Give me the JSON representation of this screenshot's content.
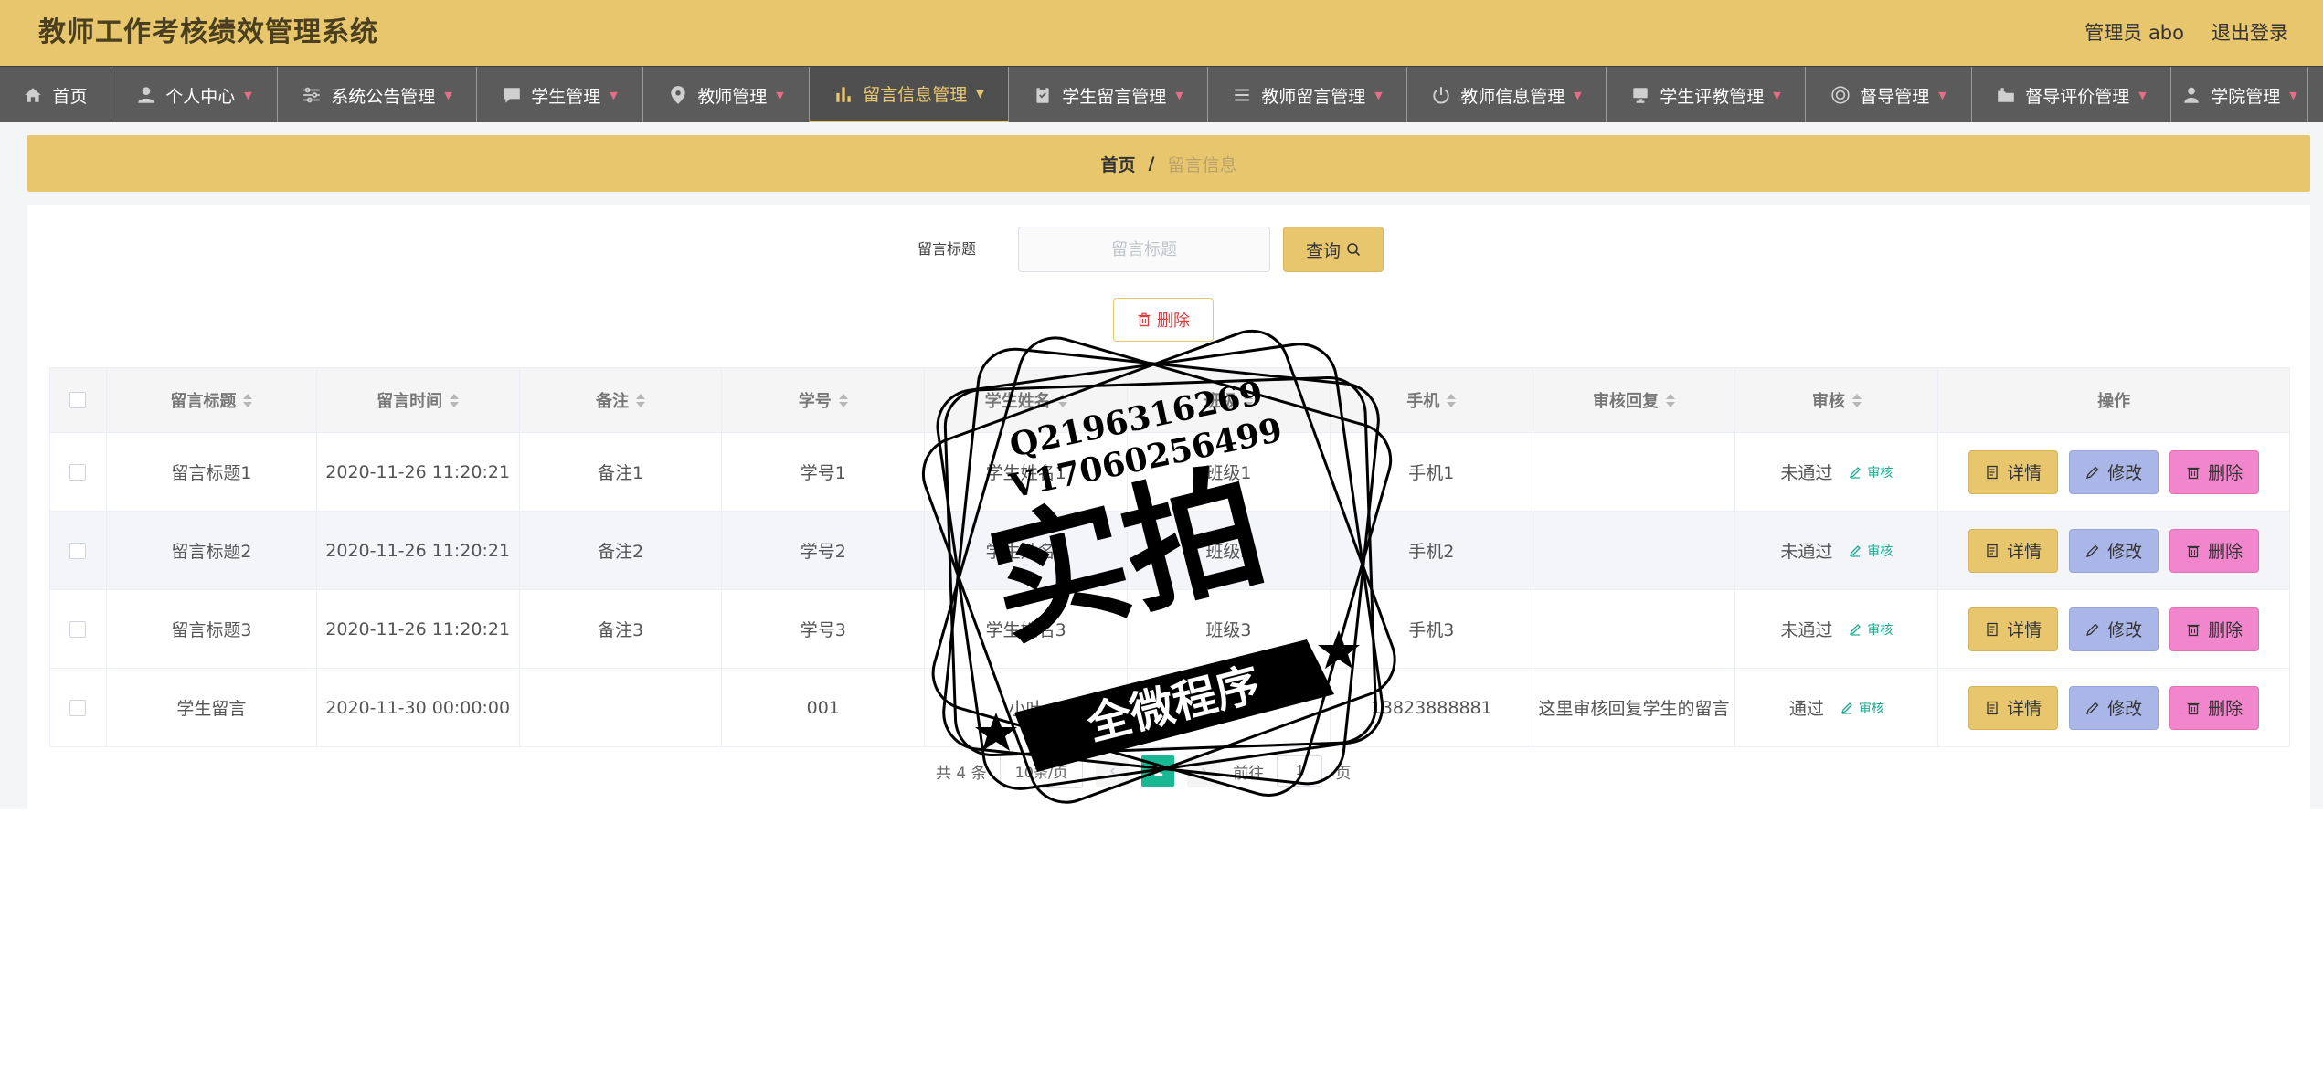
{
  "header": {
    "title": "教师工作考核绩效管理系统",
    "user": "管理员 abo",
    "logout": "退出登录"
  },
  "nav": {
    "items": [
      {
        "label": "首页",
        "icon": "home-icon",
        "has_arrow": false
      },
      {
        "label": "个人中心",
        "icon": "user-icon",
        "has_arrow": true
      },
      {
        "label": "系统公告管理",
        "icon": "sliders-icon",
        "has_arrow": true
      },
      {
        "label": "学生管理",
        "icon": "chat-icon",
        "has_arrow": true
      },
      {
        "label": "教师管理",
        "icon": "location-icon",
        "has_arrow": true
      },
      {
        "label": "留言信息管理",
        "icon": "bar-chart-icon",
        "has_arrow": true,
        "active": true
      },
      {
        "label": "学生留言管理",
        "icon": "clipboard-icon",
        "has_arrow": true
      },
      {
        "label": "教师留言管理",
        "icon": "list-icon",
        "has_arrow": true
      },
      {
        "label": "教师信息管理",
        "icon": "power-icon",
        "has_arrow": true
      },
      {
        "label": "学生评教管理",
        "icon": "monitor-icon",
        "has_arrow": true
      },
      {
        "label": "督导管理",
        "icon": "globe-icon",
        "has_arrow": true
      },
      {
        "label": "督导评价管理",
        "icon": "folder-icon",
        "has_arrow": true
      },
      {
        "label": "学院管理",
        "icon": "person-icon",
        "has_arrow": true
      }
    ]
  },
  "breadcrumb": {
    "home": "首页",
    "separator": "/",
    "current": "留言信息"
  },
  "search": {
    "label": "留言标题",
    "placeholder": "留言标题",
    "query_button": "查询"
  },
  "toolbar": {
    "delete_button": "删除"
  },
  "table": {
    "columns": [
      "留言标题",
      "留言时间",
      "备注",
      "学号",
      "学生姓名",
      "班级",
      "手机",
      "审核回复",
      "审核",
      "操作"
    ],
    "rows": [
      {
        "title": "留言标题1",
        "time": "2020-11-26 11:20:21",
        "note": "备注1",
        "student_no": "学号1",
        "student_name": "学生姓名1",
        "class": "班级1",
        "phone": "手机1",
        "reply": "",
        "status": "未通过"
      },
      {
        "title": "留言标题2",
        "time": "2020-11-26 11:20:21",
        "note": "备注2",
        "student_no": "学号2",
        "student_name": "学生姓名2",
        "class": "班级2",
        "phone": "手机2",
        "reply": "",
        "status": "未通过"
      },
      {
        "title": "留言标题3",
        "time": "2020-11-26 11:20:21",
        "note": "备注3",
        "student_no": "学号3",
        "student_name": "学生姓名3",
        "class": "班级3",
        "phone": "手机3",
        "reply": "",
        "status": "未通过"
      },
      {
        "title": "学生留言",
        "time": "2020-11-30 00:00:00",
        "note": "",
        "student_no": "001",
        "student_name": "小叶",
        "class": "",
        "phone": "13823888881",
        "reply": "这里审核回复学生的留言",
        "status": "通过"
      }
    ],
    "audit_link": "审核",
    "actions": {
      "detail": "详情",
      "edit": "修改",
      "delete": "删除"
    }
  },
  "pagination": {
    "total": "共 4 条",
    "page_size": "10条/页",
    "current_page": "1",
    "goto_prefix": "前往",
    "goto_value": "1",
    "goto_suffix": "页"
  },
  "watermark": {
    "line1": "Q2196316269",
    "line2": "V17060256499",
    "main": "实拍",
    "banner": "全微程序"
  },
  "colors": {
    "accent": "#e8c66d",
    "nav_bg": "#5b5b5b",
    "detail_btn": "#e8c66d",
    "edit_btn": "#aab6e8",
    "delete_btn": "#f286cc",
    "audit_link": "#1fa890",
    "pager_active": "#18b892"
  }
}
